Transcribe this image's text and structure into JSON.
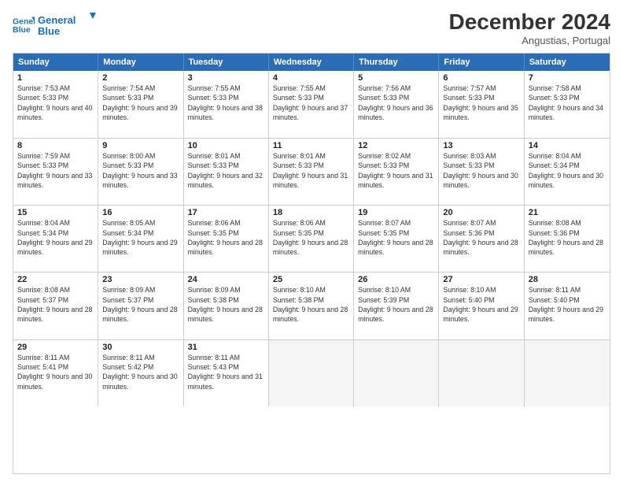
{
  "header": {
    "logo_line1": "General",
    "logo_line2": "Blue",
    "month_title": "December 2024",
    "location": "Angustias, Portugal"
  },
  "weekdays": [
    "Sunday",
    "Monday",
    "Tuesday",
    "Wednesday",
    "Thursday",
    "Friday",
    "Saturday"
  ],
  "weeks": [
    [
      {
        "day": "1",
        "sunrise": "7:53 AM",
        "sunset": "5:33 PM",
        "daylight": "9 hours and 40 minutes."
      },
      {
        "day": "2",
        "sunrise": "7:54 AM",
        "sunset": "5:33 PM",
        "daylight": "9 hours and 39 minutes."
      },
      {
        "day": "3",
        "sunrise": "7:55 AM",
        "sunset": "5:33 PM",
        "daylight": "9 hours and 38 minutes."
      },
      {
        "day": "4",
        "sunrise": "7:55 AM",
        "sunset": "5:33 PM",
        "daylight": "9 hours and 37 minutes."
      },
      {
        "day": "5",
        "sunrise": "7:56 AM",
        "sunset": "5:33 PM",
        "daylight": "9 hours and 36 minutes."
      },
      {
        "day": "6",
        "sunrise": "7:57 AM",
        "sunset": "5:33 PM",
        "daylight": "9 hours and 35 minutes."
      },
      {
        "day": "7",
        "sunrise": "7:58 AM",
        "sunset": "5:33 PM",
        "daylight": "9 hours and 34 minutes."
      }
    ],
    [
      {
        "day": "8",
        "sunrise": "7:59 AM",
        "sunset": "5:33 PM",
        "daylight": "9 hours and 33 minutes."
      },
      {
        "day": "9",
        "sunrise": "8:00 AM",
        "sunset": "5:33 PM",
        "daylight": "9 hours and 33 minutes."
      },
      {
        "day": "10",
        "sunrise": "8:01 AM",
        "sunset": "5:33 PM",
        "daylight": "9 hours and 32 minutes."
      },
      {
        "day": "11",
        "sunrise": "8:01 AM",
        "sunset": "5:33 PM",
        "daylight": "9 hours and 31 minutes."
      },
      {
        "day": "12",
        "sunrise": "8:02 AM",
        "sunset": "5:33 PM",
        "daylight": "9 hours and 31 minutes."
      },
      {
        "day": "13",
        "sunrise": "8:03 AM",
        "sunset": "5:33 PM",
        "daylight": "9 hours and 30 minutes."
      },
      {
        "day": "14",
        "sunrise": "8:04 AM",
        "sunset": "5:34 PM",
        "daylight": "9 hours and 30 minutes."
      }
    ],
    [
      {
        "day": "15",
        "sunrise": "8:04 AM",
        "sunset": "5:34 PM",
        "daylight": "9 hours and 29 minutes."
      },
      {
        "day": "16",
        "sunrise": "8:05 AM",
        "sunset": "5:34 PM",
        "daylight": "9 hours and 29 minutes."
      },
      {
        "day": "17",
        "sunrise": "8:06 AM",
        "sunset": "5:35 PM",
        "daylight": "9 hours and 28 minutes."
      },
      {
        "day": "18",
        "sunrise": "8:06 AM",
        "sunset": "5:35 PM",
        "daylight": "9 hours and 28 minutes."
      },
      {
        "day": "19",
        "sunrise": "8:07 AM",
        "sunset": "5:35 PM",
        "daylight": "9 hours and 28 minutes."
      },
      {
        "day": "20",
        "sunrise": "8:07 AM",
        "sunset": "5:36 PM",
        "daylight": "9 hours and 28 minutes."
      },
      {
        "day": "21",
        "sunrise": "8:08 AM",
        "sunset": "5:36 PM",
        "daylight": "9 hours and 28 minutes."
      }
    ],
    [
      {
        "day": "22",
        "sunrise": "8:08 AM",
        "sunset": "5:37 PM",
        "daylight": "9 hours and 28 minutes."
      },
      {
        "day": "23",
        "sunrise": "8:09 AM",
        "sunset": "5:37 PM",
        "daylight": "9 hours and 28 minutes."
      },
      {
        "day": "24",
        "sunrise": "8:09 AM",
        "sunset": "5:38 PM",
        "daylight": "9 hours and 28 minutes."
      },
      {
        "day": "25",
        "sunrise": "8:10 AM",
        "sunset": "5:38 PM",
        "daylight": "9 hours and 28 minutes."
      },
      {
        "day": "26",
        "sunrise": "8:10 AM",
        "sunset": "5:39 PM",
        "daylight": "9 hours and 28 minutes."
      },
      {
        "day": "27",
        "sunrise": "8:10 AM",
        "sunset": "5:40 PM",
        "daylight": "9 hours and 29 minutes."
      },
      {
        "day": "28",
        "sunrise": "8:11 AM",
        "sunset": "5:40 PM",
        "daylight": "9 hours and 29 minutes."
      }
    ],
    [
      {
        "day": "29",
        "sunrise": "8:11 AM",
        "sunset": "5:41 PM",
        "daylight": "9 hours and 30 minutes."
      },
      {
        "day": "30",
        "sunrise": "8:11 AM",
        "sunset": "5:42 PM",
        "daylight": "9 hours and 30 minutes."
      },
      {
        "day": "31",
        "sunrise": "8:11 AM",
        "sunset": "5:43 PM",
        "daylight": "9 hours and 31 minutes."
      },
      null,
      null,
      null,
      null
    ]
  ]
}
